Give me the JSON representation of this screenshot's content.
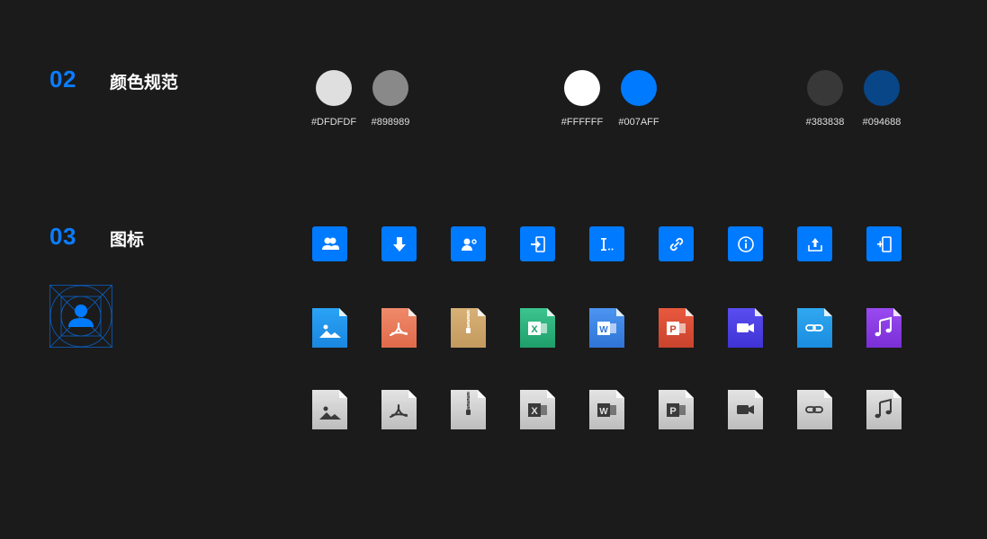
{
  "sections": {
    "colors": {
      "number": "02",
      "title": "颜色规范"
    },
    "icons": {
      "number": "03",
      "title": "图标"
    }
  },
  "swatches": [
    {
      "hex": "#DFDFDF",
      "label": "#DFDFDF"
    },
    {
      "hex": "#898989",
      "label": "#898989"
    },
    {
      "hex": "#FFFFFF",
      "label": "#FFFFFF"
    },
    {
      "hex": "#007AFF",
      "label": "#007AFF"
    },
    {
      "hex": "#383838",
      "label": "#383838"
    },
    {
      "hex": "#094688",
      "label": "#094688"
    }
  ],
  "action_icons": [
    "group-users-icon",
    "download-icon",
    "user-settings-icon",
    "login-icon",
    "text-cursor-icon",
    "link-icon",
    "info-icon",
    "upload-icon",
    "add-page-icon"
  ],
  "file_icons_color": [
    {
      "icon": "image-file-icon",
      "color": "#2aa3f5",
      "color2": "#1a86e0"
    },
    {
      "icon": "pdf-file-icon",
      "color": "#ef8a6a",
      "color2": "#e06a4a"
    },
    {
      "icon": "zip-file-icon",
      "color": "#d8b178",
      "color2": "#c39a5e"
    },
    {
      "icon": "excel-file-icon",
      "color": "#3cc48f",
      "color2": "#1f9f6a"
    },
    {
      "icon": "word-file-icon",
      "color": "#4c95f0",
      "color2": "#2f74d6"
    },
    {
      "icon": "powerpoint-file-icon",
      "color": "#e8593e",
      "color2": "#c9432c"
    },
    {
      "icon": "video-file-icon",
      "color": "#5a4df0",
      "color2": "#3f33d4"
    },
    {
      "icon": "link-file-icon",
      "color": "#30a8f0",
      "color2": "#1a8ce0"
    },
    {
      "icon": "audio-file-icon",
      "color": "#9a4af0",
      "color2": "#7a2ed6"
    }
  ],
  "file_icons_gray": [
    "image-file-gray-icon",
    "pdf-file-gray-icon",
    "zip-file-gray-icon",
    "excel-file-gray-icon",
    "word-file-gray-icon",
    "powerpoint-file-gray-icon",
    "video-file-gray-icon",
    "link-file-gray-icon",
    "audio-file-gray-icon"
  ],
  "glyph_letters": {
    "excel": "X",
    "word": "W",
    "powerpoint": "P"
  },
  "accent": "#007AFF"
}
